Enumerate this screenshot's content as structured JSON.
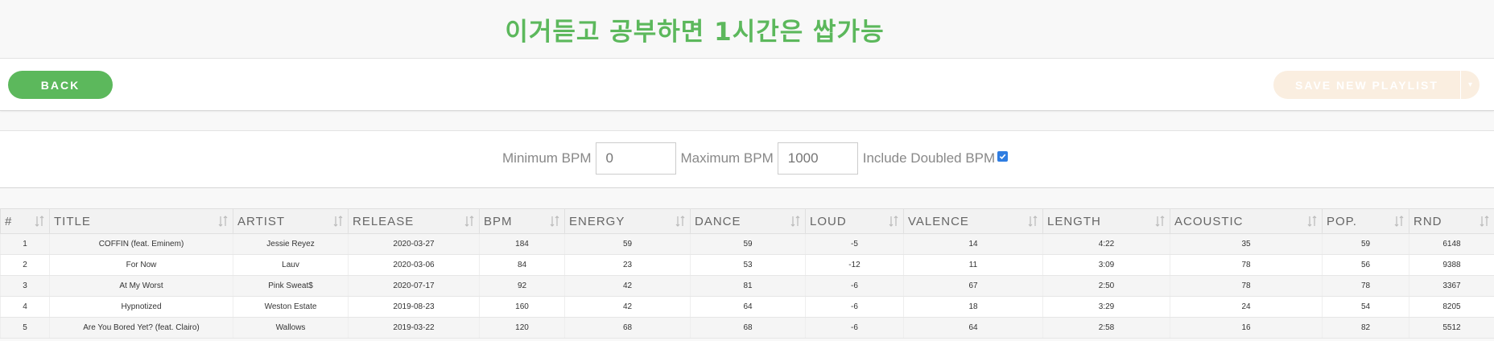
{
  "page": {
    "title": "이거듣고 공부하면 1시간은 쌉가능"
  },
  "toolbar": {
    "back_label": "BACK",
    "save_label": "SAVE NEW PLAYLIST",
    "colors": {
      "back": "#5cb85c",
      "save_disabled": "#faeee0"
    }
  },
  "filters": {
    "min_label": "Minimum BPM",
    "min_placeholder": "0",
    "max_label": "Maximum BPM",
    "max_placeholder": "1000",
    "doubled_label": "Include Doubled BPM",
    "doubled_checked": true
  },
  "table": {
    "columns": [
      "#",
      "TITLE",
      "ARTIST",
      "RELEASE",
      "BPM",
      "ENERGY",
      "DANCE",
      "LOUD",
      "VALENCE",
      "LENGTH",
      "ACOUSTIC",
      "POP.",
      "RND"
    ],
    "rows": [
      [
        "1",
        "COFFIN (feat. Eminem)",
        "Jessie Reyez",
        "2020-03-27",
        "184",
        "59",
        "59",
        "-5",
        "14",
        "4:22",
        "35",
        "59",
        "6148"
      ],
      [
        "2",
        "For Now",
        "Lauv",
        "2020-03-06",
        "84",
        "23",
        "53",
        "-12",
        "11",
        "3:09",
        "78",
        "56",
        "9388"
      ],
      [
        "3",
        "At My Worst",
        "Pink Sweat$",
        "2020-07-17",
        "92",
        "42",
        "81",
        "-6",
        "67",
        "2:50",
        "78",
        "78",
        "3367"
      ],
      [
        "4",
        "Hypnotized",
        "Weston Estate",
        "2019-08-23",
        "160",
        "42",
        "64",
        "-6",
        "18",
        "3:29",
        "24",
        "54",
        "8205"
      ],
      [
        "5",
        "Are You Bored Yet? (feat. Clairo)",
        "Wallows",
        "2019-03-22",
        "120",
        "68",
        "68",
        "-6",
        "64",
        "2:58",
        "16",
        "82",
        "5512"
      ]
    ]
  }
}
